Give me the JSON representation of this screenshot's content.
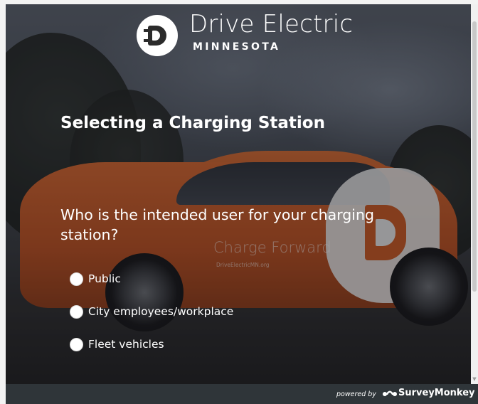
{
  "brand": {
    "title": "Drive Electric",
    "subtitle": "MINNESOTA",
    "logo_icon": "plug-d-icon"
  },
  "background": {
    "car_slogan": "Charge Forward",
    "car_url": "DriveElectricMN.org"
  },
  "survey": {
    "page_title": "Selecting a Charging Station",
    "question": "Who is the intended user for your charging station?",
    "options": [
      {
        "label": "Public",
        "selected": false
      },
      {
        "label": "City employees/workplace",
        "selected": false
      },
      {
        "label": "Fleet vehicles",
        "selected": false
      }
    ]
  },
  "footer": {
    "powered_by": "powered by",
    "provider": "SurveyMonkey",
    "provider_icon": "surveymonkey-logo-icon"
  },
  "colors": {
    "footer_bg": "#2f3539",
    "car_orange": "#d4642c",
    "text": "#ffffff"
  }
}
